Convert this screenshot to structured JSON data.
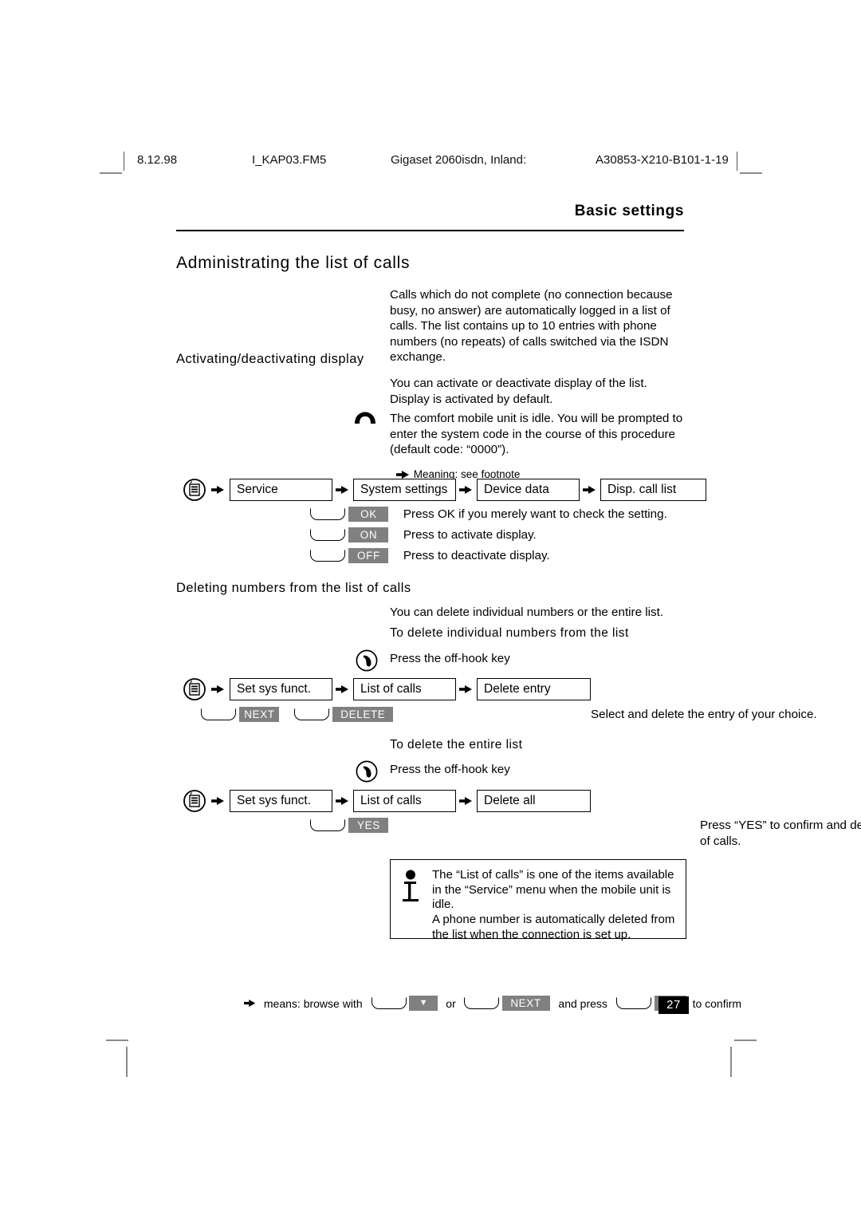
{
  "header": {
    "date": "8.12.98",
    "file": "I_KAP03.FM5",
    "product": "Gigaset 2060isdn, Inland:",
    "code": "A30853-X210-B101-1-19"
  },
  "chapter_title": "Basic settings",
  "page_title": "Administrating the list of calls",
  "intro": "Calls which do not complete (no connection because busy, no answer) are automatically logged in a list of calls. The list contains up to 10 entries with phone numbers (no repeats) of calls switched via the ISDN exchange.",
  "section_activate": {
    "heading": "Activating/deactivating display",
    "paragraph": "You can activate or deactivate display of the list. Display is activated by default.",
    "idle_note": "The comfort mobile unit is idle. You will be prompted to enter the system code in the course of this procedure (default code: “0000”).",
    "footnote_ref": "Meaning: see footnote",
    "chain": [
      "Service",
      "System settings",
      "Device data",
      "Disp. call list"
    ],
    "keys": [
      {
        "badge": "OK",
        "text": "Press OK if you merely want to check the setting."
      },
      {
        "badge": "ON",
        "text": "Press to activate display."
      },
      {
        "badge": "OFF",
        "text": "Press to deactivate display."
      }
    ]
  },
  "section_delete": {
    "heading": "Deleting numbers from the list of calls",
    "paragraph": "You can delete individual numbers or the entire list.",
    "sub_individual": "To delete individual numbers from the list",
    "offhook_text_1": "Press the off-hook key",
    "chain_individual": [
      "Set sys funct.",
      "List of calls",
      "Delete entry"
    ],
    "keys_individual": {
      "badge_1": "NEXT",
      "badge_2": "DELETE",
      "text": "Select and delete the entry of your choice."
    },
    "sub_entire": "To delete the entire list",
    "offhook_text_2": "Press the off-hook key",
    "chain_entire": [
      "Set sys funct.",
      "List of calls",
      "Delete all"
    ],
    "keys_entire": {
      "badge": "YES",
      "text": "Press “YES” to confirm and delete all entries in the list of calls."
    }
  },
  "note_box": {
    "paragraph_1": "The “List of calls” is one of the items available in the “Service” menu when the mobile unit is idle.",
    "paragraph_2": "A phone number is automatically deleted from the list when the connection is set up."
  },
  "footer": {
    "lead": "means: browse with",
    "badge_triangle": "▼",
    "or": "or",
    "badge_next": "NEXT",
    "middle": "and press",
    "badge_ok": "OK",
    "tail": "to confirm",
    "page_number": "27"
  },
  "icons": {
    "menu": "menu-key-icon",
    "onhook": "on-hook-handset-icon",
    "offhook": "off-hook-key-icon",
    "arrow": "step-arrow-icon",
    "info": "info-i-icon"
  }
}
